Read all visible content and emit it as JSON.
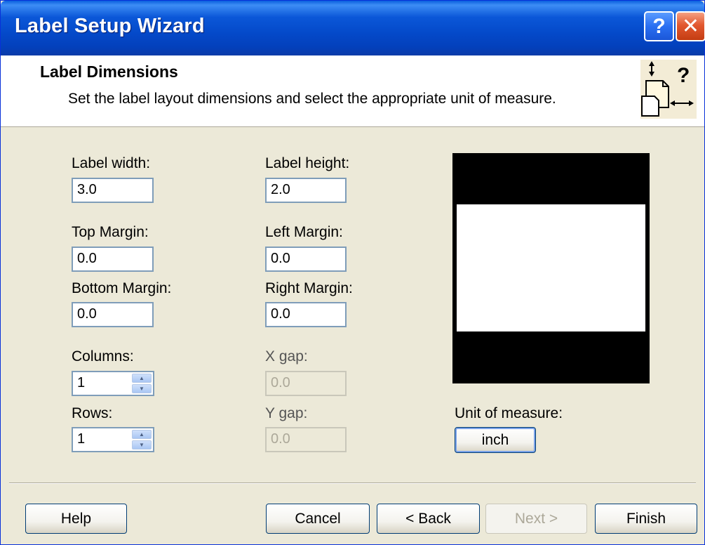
{
  "window": {
    "title": "Label Setup Wizard",
    "help_glyph": "?",
    "close_glyph": "✕"
  },
  "header": {
    "title": "Label Dimensions",
    "subtitle": "Set the label layout dimensions and select the appropriate unit of measure.",
    "icon": "label-dimensions-icon"
  },
  "fields": {
    "label_width": {
      "label": "Label width:",
      "value": "3.0"
    },
    "label_height": {
      "label": "Label height:",
      "value": "2.0"
    },
    "top_margin": {
      "label": "Top Margin:",
      "value": "0.0"
    },
    "left_margin": {
      "label": "Left Margin:",
      "value": "0.0"
    },
    "bottom_margin": {
      "label": "Bottom Margin:",
      "value": "0.0"
    },
    "right_margin": {
      "label": "Right Margin:",
      "value": "0.0"
    },
    "columns": {
      "label": "Columns:",
      "value": "1"
    },
    "x_gap": {
      "label": "X gap:",
      "value": "0.0"
    },
    "rows": {
      "label": "Rows:",
      "value": "1"
    },
    "y_gap": {
      "label": "Y gap:",
      "value": "0.0"
    }
  },
  "unit": {
    "label": "Unit of measure:",
    "value": "inch"
  },
  "buttons": {
    "help": "Help",
    "cancel": "Cancel",
    "back": "< Back",
    "next": "Next >",
    "finish": "Finish"
  },
  "colors": {
    "titlebar": "#0449c9",
    "dialog_bg": "#ece9d8",
    "field_border": "#7f9db9",
    "close_button": "#e2582f"
  }
}
